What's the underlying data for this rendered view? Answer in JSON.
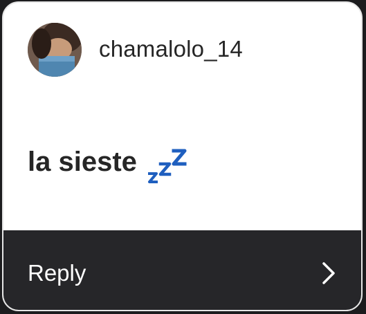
{
  "post": {
    "username": "chamalolo_14",
    "message": "la sieste"
  },
  "icons": {
    "avatar": "profile-photo",
    "zzz": "sleeping-zzz-emoji",
    "chevron": "chevron-right-icon"
  },
  "reply": {
    "label": "Reply"
  },
  "colors": {
    "text": "#262626",
    "reply_bar": "#262629",
    "zzz_blue": "#1f5fbf"
  }
}
